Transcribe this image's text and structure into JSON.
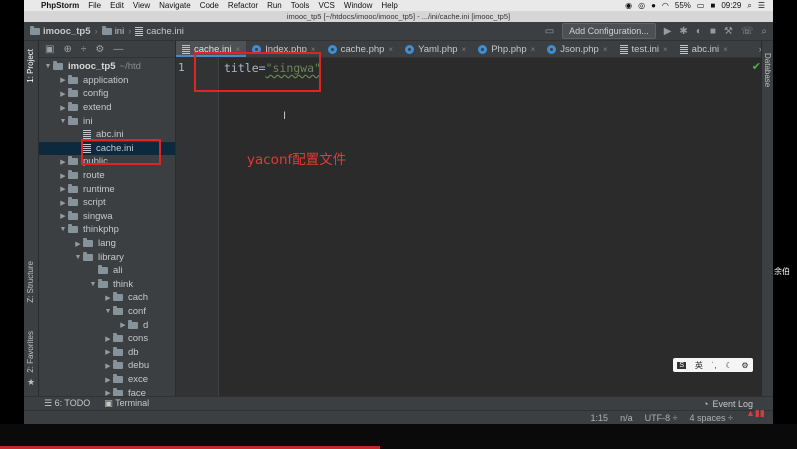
{
  "menubar": {
    "app": "PhpStorm",
    "items": [
      "File",
      "Edit",
      "View",
      "Navigate",
      "Code",
      "Refactor",
      "Run",
      "Tools",
      "VCS",
      "Window",
      "Help"
    ],
    "battery": "55%",
    "time": "09:29"
  },
  "window": {
    "title": "imooc_tp5 [~/htdocs/imooc/imooc_tp5] - .../ini/cache.ini [imooc_tp5]"
  },
  "navbar": {
    "crumbs": [
      "imooc_tp5",
      "ini",
      "cache.ini"
    ],
    "add_config": "Add Configuration..."
  },
  "left_stripe": {
    "project": "1: Project",
    "structure": "Z: Structure",
    "favorites": "2: Favorites"
  },
  "right_stripe": {
    "database": "Database"
  },
  "tree": [
    {
      "label": "imooc_tp5",
      "suffix": "~/htd",
      "depth": 0,
      "kind": "root",
      "expanded": true
    },
    {
      "label": "application",
      "depth": 1,
      "kind": "folder",
      "expanded": false
    },
    {
      "label": "config",
      "depth": 1,
      "kind": "folder",
      "expanded": false
    },
    {
      "label": "extend",
      "depth": 1,
      "kind": "folder",
      "expanded": false
    },
    {
      "label": "ini",
      "depth": 1,
      "kind": "folder",
      "expanded": true
    },
    {
      "label": "abc.ini",
      "depth": 2,
      "kind": "file"
    },
    {
      "label": "cache.ini",
      "depth": 2,
      "kind": "file",
      "selected": true
    },
    {
      "label": "public",
      "depth": 1,
      "kind": "folder",
      "expanded": false
    },
    {
      "label": "route",
      "depth": 1,
      "kind": "folder",
      "expanded": false
    },
    {
      "label": "runtime",
      "depth": 1,
      "kind": "folder",
      "expanded": false
    },
    {
      "label": "script",
      "depth": 1,
      "kind": "folder",
      "expanded": false
    },
    {
      "label": "singwa",
      "depth": 1,
      "kind": "folder",
      "expanded": false
    },
    {
      "label": "thinkphp",
      "depth": 1,
      "kind": "folder",
      "expanded": true
    },
    {
      "label": "lang",
      "depth": 2,
      "kind": "folder",
      "expanded": false
    },
    {
      "label": "library",
      "depth": 2,
      "kind": "folder",
      "expanded": true
    },
    {
      "label": "ali",
      "depth": 3,
      "kind": "folder",
      "leaf": true
    },
    {
      "label": "think",
      "depth": 3,
      "kind": "folder",
      "expanded": true
    },
    {
      "label": "cach",
      "depth": 4,
      "kind": "folder",
      "expanded": false
    },
    {
      "label": "conf",
      "depth": 4,
      "kind": "folder",
      "expanded": true
    },
    {
      "label": "d",
      "depth": 5,
      "kind": "folder",
      "expanded": false
    },
    {
      "label": "cons",
      "depth": 4,
      "kind": "folder",
      "expanded": false
    },
    {
      "label": "db",
      "depth": 4,
      "kind": "folder",
      "expanded": false
    },
    {
      "label": "debu",
      "depth": 4,
      "kind": "folder",
      "expanded": false
    },
    {
      "label": "exce",
      "depth": 4,
      "kind": "folder",
      "expanded": false
    },
    {
      "label": "face",
      "depth": 4,
      "kind": "folder",
      "expanded": false
    }
  ],
  "tabs": [
    {
      "label": "cache.ini",
      "icon": "ini",
      "active": true
    },
    {
      "label": "Index.php",
      "icon": "php"
    },
    {
      "label": "cache.php",
      "icon": "php"
    },
    {
      "label": "Yaml.php",
      "icon": "php"
    },
    {
      "label": "Php.php",
      "icon": "php"
    },
    {
      "label": "Json.php",
      "icon": "php"
    },
    {
      "label": "test.ini",
      "icon": "ini"
    },
    {
      "label": "abc.ini",
      "icon": "ini"
    }
  ],
  "tabs_more": "»≡",
  "editor": {
    "line_number": "1",
    "code_key": "title",
    "code_eq": "=",
    "code_value": "\"singwa\""
  },
  "annotation": "yaconf配置文件",
  "ime": {
    "lang": "英"
  },
  "right_note": "余伯",
  "bottom_tools": {
    "todo": "6: TODO",
    "terminal": "Terminal",
    "event_log": "Event Log"
  },
  "status": {
    "position": "1:15",
    "na": "n/a",
    "encoding": "UTF-8 ÷",
    "indent": "4 spaces ÷"
  }
}
